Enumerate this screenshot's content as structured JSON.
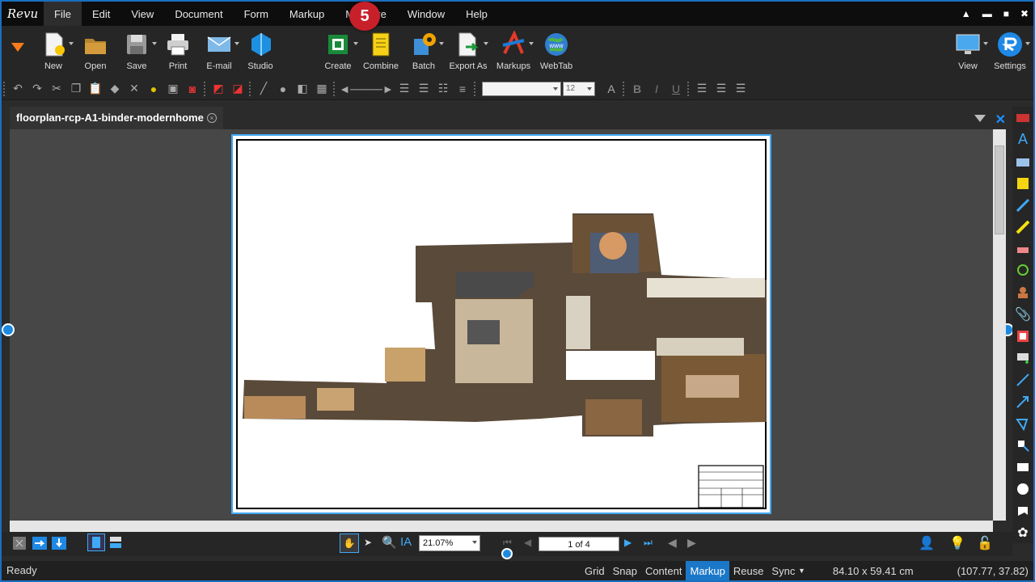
{
  "app": {
    "logo_text": "Revu"
  },
  "menu": {
    "items": [
      "File",
      "Edit",
      "View",
      "Document",
      "Form",
      "Markup",
      "Measure",
      "Window",
      "Help"
    ],
    "active": "File"
  },
  "step_badge": "5",
  "ribbon": {
    "new": "New",
    "open": "Open",
    "save": "Save",
    "print": "Print",
    "email": "E-mail",
    "studio": "Studio",
    "create": "Create",
    "combine": "Combine",
    "batch": "Batch",
    "export_as": "Export As",
    "markups": "Markups",
    "webtab": "WebTab",
    "view": "View",
    "settings": "Settings",
    "webtab_icon_text": "www"
  },
  "format_bar": {
    "font_size": "12",
    "bold": "B",
    "italic": "I",
    "underline": "U"
  },
  "document": {
    "tab_title": "floorplan-rcp-A1-binder-modernhome"
  },
  "nav": {
    "zoom": "21.07%",
    "page": "1 of 4"
  },
  "status": {
    "ready": "Ready",
    "toggles": [
      "Grid",
      "Snap",
      "Content",
      "Markup",
      "Reuse",
      "Sync"
    ],
    "active_toggle": "Markup",
    "page_size": "84.10 x 59.41 cm",
    "cursor": "(107.77, 37.82)"
  },
  "colors": {
    "accent": "#1b78c8",
    "badge": "#c8202a",
    "menubar": "#0d0d0d",
    "canvas": "#474747"
  }
}
